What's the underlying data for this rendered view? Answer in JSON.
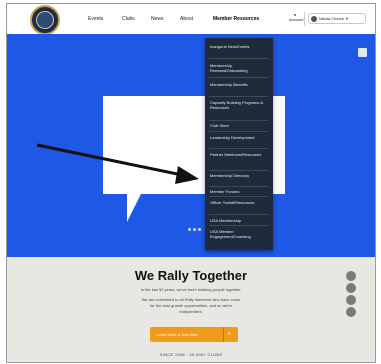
{
  "nav": {
    "items": [
      "Events",
      "Clubs",
      "News",
      "About",
      "Member Resources"
    ],
    "active_index": 4,
    "account_label": "Account",
    "user_label": "Nikola Chetok"
  },
  "dropdown": {
    "items": [
      "Inaugural Nets/Events",
      "Membership Renewal/Onboarding",
      "Membership Benefits",
      "Capacity Building Programs & Resources",
      "Club Store",
      "Leadership Development",
      "Partner Webinars/Resources",
      "Membership Directory",
      "Member Forums",
      "Officer Toolkit/Resources",
      "USA Membership",
      "USA Member Engagement/Coaching"
    ]
  },
  "hero": {
    "colors": {
      "background": "#1d58e6",
      "bubble": "#ffffff",
      "dropdown": "#1f2a3b"
    }
  },
  "bottom": {
    "title": "We Rally Together",
    "line1": "In the last 50 years, we've been building people together.",
    "paragraph": "We are committed to all Rally members who have come for the best growth opportunities, and so we're Independent.",
    "cta_label": "Learn More & Join Now",
    "footline": "SINCE 1948 · 35,000+ CLUBS"
  }
}
